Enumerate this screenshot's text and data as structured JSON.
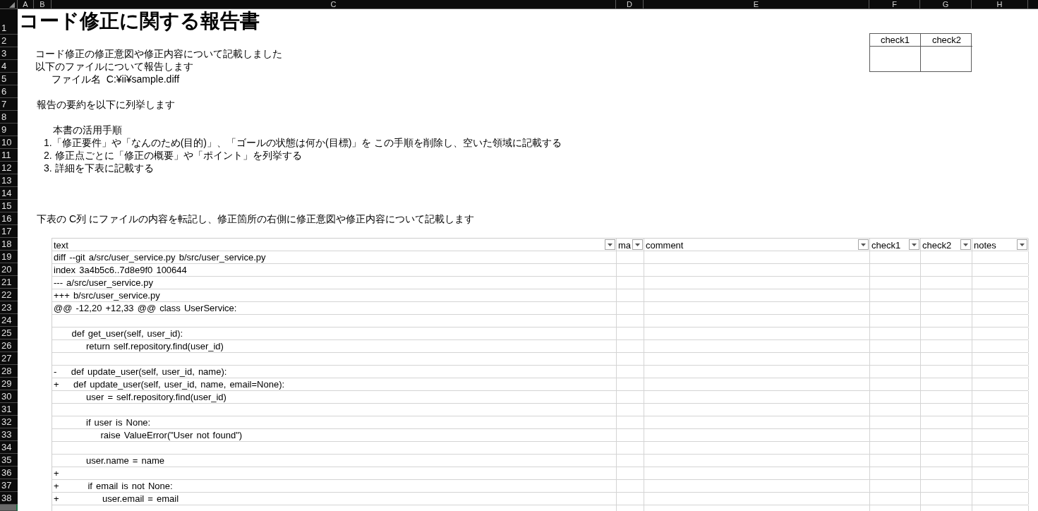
{
  "column_headers": [
    {
      "label": "A"
    },
    {
      "label": "B"
    },
    {
      "label": "C"
    },
    {
      "label": "D"
    },
    {
      "label": "E"
    },
    {
      "label": "F"
    },
    {
      "label": "G"
    },
    {
      "label": "H"
    }
  ],
  "row_headers": [
    {
      "label": "1",
      "selected": false
    },
    {
      "label": "2",
      "selected": false
    },
    {
      "label": "3",
      "selected": false
    },
    {
      "label": "4",
      "selected": false
    },
    {
      "label": "5",
      "selected": false
    },
    {
      "label": "6",
      "selected": false
    },
    {
      "label": "7",
      "selected": false
    },
    {
      "label": "8",
      "selected": false
    },
    {
      "label": "9",
      "selected": false
    },
    {
      "label": "10",
      "selected": false
    },
    {
      "label": "11",
      "selected": false
    },
    {
      "label": "12",
      "selected": false
    },
    {
      "label": "13",
      "selected": false
    },
    {
      "label": "14",
      "selected": false
    },
    {
      "label": "15",
      "selected": false
    },
    {
      "label": "16",
      "selected": false
    },
    {
      "label": "17",
      "selected": false
    },
    {
      "label": "18",
      "selected": false
    },
    {
      "label": "19",
      "selected": false
    },
    {
      "label": "20",
      "selected": false
    },
    {
      "label": "21",
      "selected": false
    },
    {
      "label": "22",
      "selected": false
    },
    {
      "label": "23",
      "selected": false
    },
    {
      "label": "24",
      "selected": false
    },
    {
      "label": "25",
      "selected": false
    },
    {
      "label": "26",
      "selected": false
    },
    {
      "label": "27",
      "selected": false
    },
    {
      "label": "28",
      "selected": false
    },
    {
      "label": "29",
      "selected": false
    },
    {
      "label": "30",
      "selected": false
    },
    {
      "label": "31",
      "selected": false
    },
    {
      "label": "32",
      "selected": false
    },
    {
      "label": "33",
      "selected": false
    },
    {
      "label": "34",
      "selected": false
    },
    {
      "label": "35",
      "selected": false
    },
    {
      "label": "36",
      "selected": false
    },
    {
      "label": "37",
      "selected": false
    },
    {
      "label": "38",
      "selected": false
    },
    {
      "selected": true
    }
  ],
  "title": "コード修正に関する報告書",
  "approval_table": {
    "columns": [
      "check1",
      "check2"
    ]
  },
  "intro": [
    "コード修正の修正意図や修正内容について記載しました",
    "以下のファイルについて報告します"
  ],
  "file_line": "ファイル名  C:¥ii¥sample.diff",
  "summary_line": "報告の要約を以下に列挙します",
  "usage_guide": {
    "heading": "本書の活用手順",
    "steps": [
      "1.「修正要件」や「なんのため(目的)」、「ゴールの状態は何か(目標)」を この手順を削除し、空いた領域に記載する",
      "2. 修正点ごとに「修正の概要」や「ポイント」を列挙する",
      "3. 詳細を下表に記載する"
    ]
  },
  "table_note": "下表の C列 にファイルの内容を転記し、修正箇所の右側に修正意図や修正内容について記載します",
  "table": {
    "columns": [
      {
        "label": "text"
      },
      {
        "label": "ma"
      },
      {
        "label": "comment"
      },
      {
        "label": "check1"
      },
      {
        "label": "check2"
      },
      {
        "label": "notes"
      }
    ],
    "rows": [
      {
        "kind": "code",
        "text": "diff --git a/src/user_service.py b/src/user_service.py"
      },
      {
        "kind": "code",
        "text": "index 3a4b5c6..7d8e9f0 100644"
      },
      {
        "kind": "code",
        "text": "--- a/src/user_service.py"
      },
      {
        "kind": "code",
        "text": "+++ b/src/user_service.py"
      },
      {
        "kind": "code",
        "text": "@@ -12,20 +12,33 @@ class UserService:"
      },
      {
        "kind": "blank"
      },
      {
        "kind": "code",
        "text": "     def get_user(self, user_id):"
      },
      {
        "kind": "code",
        "text": "         return self.repository.find(user_id)"
      },
      {
        "kind": "blank"
      },
      {
        "kind": "code",
        "text": "-    def update_user(self, user_id, name):"
      },
      {
        "kind": "code",
        "text": "+    def update_user(self, user_id, name, email=None):"
      },
      {
        "kind": "code",
        "text": "         user = self.repository.find(user_id)"
      },
      {
        "kind": "blank"
      },
      {
        "kind": "code",
        "text": "         if user is None:"
      },
      {
        "kind": "code",
        "text": "             raise ValueError(\"User not found\")"
      },
      {
        "kind": "blank"
      },
      {
        "kind": "code",
        "text": "         user.name = name"
      },
      {
        "kind": "code",
        "text": "+"
      },
      {
        "kind": "code",
        "text": "+        if email is not None:"
      },
      {
        "kind": "code",
        "text": "+            user.email = email"
      },
      {
        "kind": "blank"
      }
    ]
  }
}
